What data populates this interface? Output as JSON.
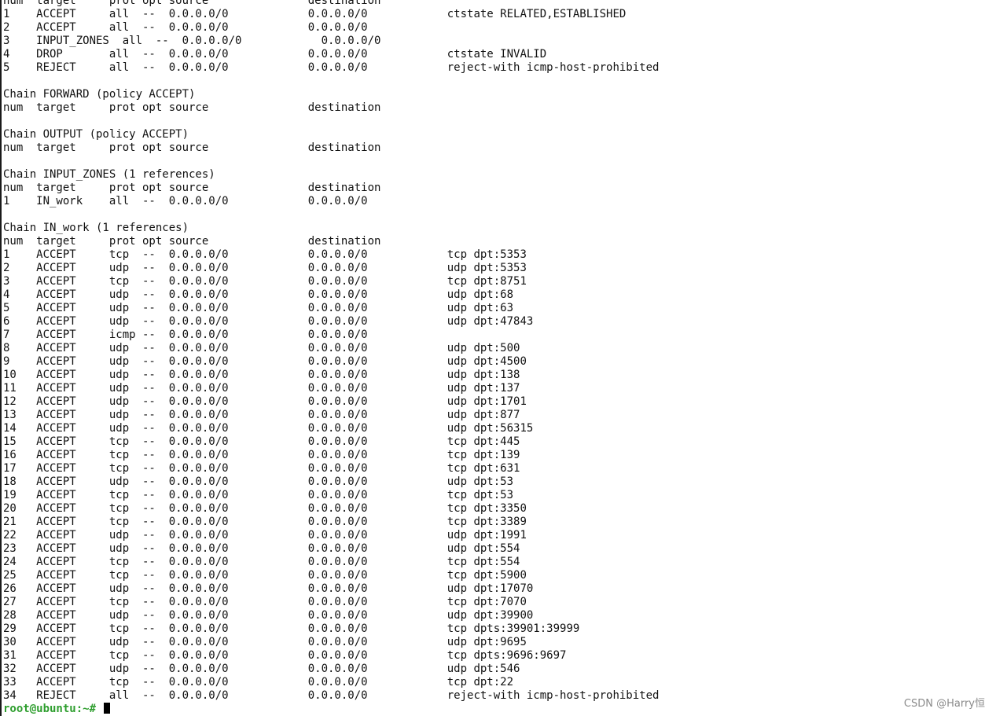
{
  "terminal": {
    "lines": [
      "num  target     prot opt source               destination",
      "1    ACCEPT     all  --  0.0.0.0/0            0.0.0.0/0            ctstate RELATED,ESTABLISHED",
      "2    ACCEPT     all  --  0.0.0.0/0            0.0.0.0/0",
      "3    INPUT_ZONES  all  --  0.0.0.0/0            0.0.0.0/0",
      "4    DROP       all  --  0.0.0.0/0            0.0.0.0/0            ctstate INVALID",
      "5    REJECT     all  --  0.0.0.0/0            0.0.0.0/0            reject-with icmp-host-prohibited",
      "",
      "Chain FORWARD (policy ACCEPT)",
      "num  target     prot opt source               destination",
      "",
      "Chain OUTPUT (policy ACCEPT)",
      "num  target     prot opt source               destination",
      "",
      "Chain INPUT_ZONES (1 references)",
      "num  target     prot opt source               destination",
      "1    IN_work    all  --  0.0.0.0/0            0.0.0.0/0",
      "",
      "Chain IN_work (1 references)",
      "num  target     prot opt source               destination",
      "1    ACCEPT     tcp  --  0.0.0.0/0            0.0.0.0/0            tcp dpt:5353",
      "2    ACCEPT     udp  --  0.0.0.0/0            0.0.0.0/0            udp dpt:5353",
      "3    ACCEPT     tcp  --  0.0.0.0/0            0.0.0.0/0            tcp dpt:8751",
      "4    ACCEPT     udp  --  0.0.0.0/0            0.0.0.0/0            udp dpt:68",
      "5    ACCEPT     udp  --  0.0.0.0/0            0.0.0.0/0            udp dpt:63",
      "6    ACCEPT     udp  --  0.0.0.0/0            0.0.0.0/0            udp dpt:47843",
      "7    ACCEPT     icmp --  0.0.0.0/0            0.0.0.0/0",
      "8    ACCEPT     udp  --  0.0.0.0/0            0.0.0.0/0            udp dpt:500",
      "9    ACCEPT     udp  --  0.0.0.0/0            0.0.0.0/0            udp dpt:4500",
      "10   ACCEPT     udp  --  0.0.0.0/0            0.0.0.0/0            udp dpt:138",
      "11   ACCEPT     udp  --  0.0.0.0/0            0.0.0.0/0            udp dpt:137",
      "12   ACCEPT     udp  --  0.0.0.0/0            0.0.0.0/0            udp dpt:1701",
      "13   ACCEPT     udp  --  0.0.0.0/0            0.0.0.0/0            udp dpt:877",
      "14   ACCEPT     udp  --  0.0.0.0/0            0.0.0.0/0            udp dpt:56315",
      "15   ACCEPT     tcp  --  0.0.0.0/0            0.0.0.0/0            tcp dpt:445",
      "16   ACCEPT     tcp  --  0.0.0.0/0            0.0.0.0/0            tcp dpt:139",
      "17   ACCEPT     tcp  --  0.0.0.0/0            0.0.0.0/0            tcp dpt:631",
      "18   ACCEPT     udp  --  0.0.0.0/0            0.0.0.0/0            udp dpt:53",
      "19   ACCEPT     tcp  --  0.0.0.0/0            0.0.0.0/0            tcp dpt:53",
      "20   ACCEPT     tcp  --  0.0.0.0/0            0.0.0.0/0            tcp dpt:3350",
      "21   ACCEPT     tcp  --  0.0.0.0/0            0.0.0.0/0            tcp dpt:3389",
      "22   ACCEPT     udp  --  0.0.0.0/0            0.0.0.0/0            udp dpt:1991",
      "23   ACCEPT     udp  --  0.0.0.0/0            0.0.0.0/0            udp dpt:554",
      "24   ACCEPT     tcp  --  0.0.0.0/0            0.0.0.0/0            tcp dpt:554",
      "25   ACCEPT     tcp  --  0.0.0.0/0            0.0.0.0/0            tcp dpt:5900",
      "26   ACCEPT     udp  --  0.0.0.0/0            0.0.0.0/0            udp dpt:17070",
      "27   ACCEPT     tcp  --  0.0.0.0/0            0.0.0.0/0            tcp dpt:7070",
      "28   ACCEPT     udp  --  0.0.0.0/0            0.0.0.0/0            udp dpt:39900",
      "29   ACCEPT     tcp  --  0.0.0.0/0            0.0.0.0/0            tcp dpts:39901:39999",
      "30   ACCEPT     udp  --  0.0.0.0/0            0.0.0.0/0            udp dpt:9695",
      "31   ACCEPT     tcp  --  0.0.0.0/0            0.0.0.0/0            tcp dpts:9696:9697",
      "32   ACCEPT     udp  --  0.0.0.0/0            0.0.0.0/0            udp dpt:546",
      "33   ACCEPT     tcp  --  0.0.0.0/0            0.0.0.0/0            tcp dpt:22",
      "34   REJECT     all  --  0.0.0.0/0            0.0.0.0/0            reject-with icmp-host-prohibited"
    ],
    "prompt": "root@ubuntu:~# "
  },
  "watermark": "CSDN @Harry恒",
  "colors": {
    "background": "#ffffff",
    "text": "#111111",
    "prompt": "#2e9e2e",
    "watermark": "#8a8a8a"
  }
}
